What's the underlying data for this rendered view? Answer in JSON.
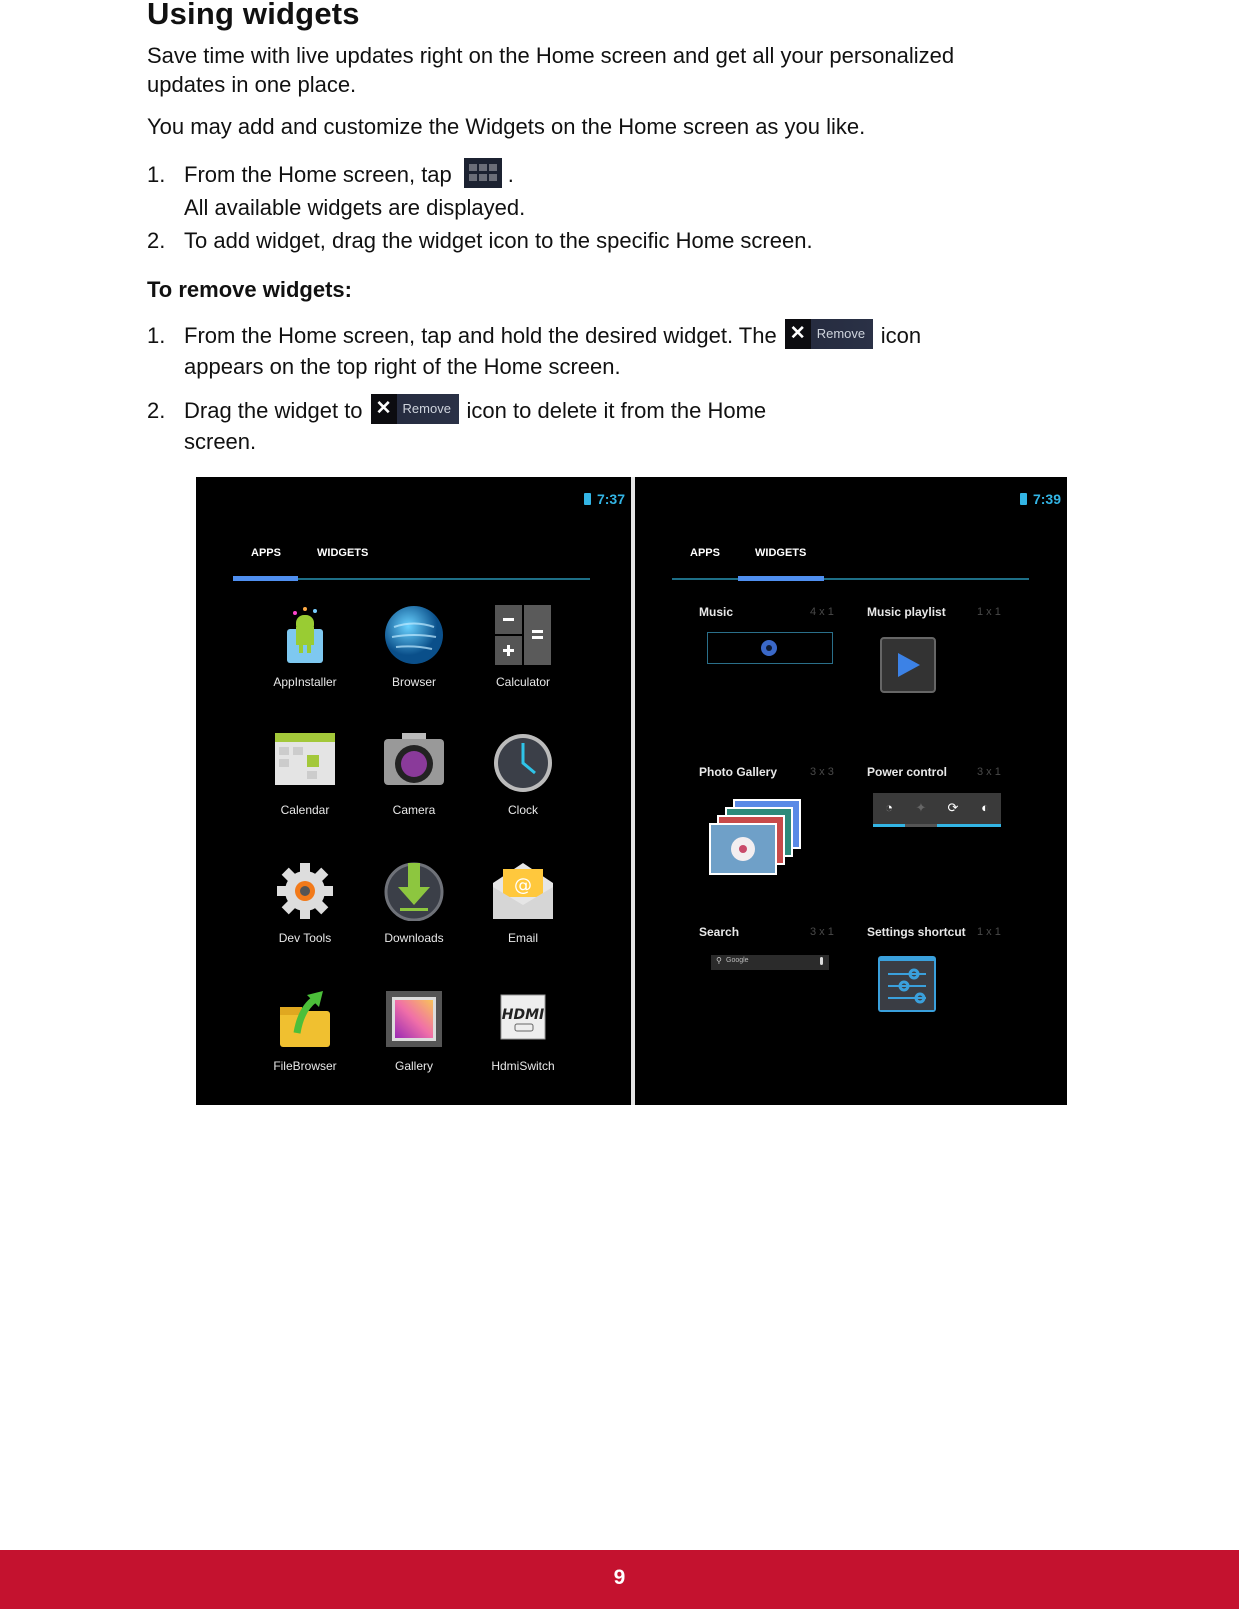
{
  "title": "Using widgets",
  "intro": [
    "Save time with live updates right on the Home screen and get all your personalized",
    "updates in one place.",
    "You may add and customize the Widgets on the Home screen as you like."
  ],
  "add_steps": [
    {
      "num": "1.",
      "text_before": "From the Home screen, tap",
      "icon": "apps-grid-icon",
      "text_after": ".",
      "sub": "All available widgets are displayed."
    },
    {
      "num": "2.",
      "text": "To add widget, drag the widget icon to the specific Home screen."
    }
  ],
  "remove_heading": "To remove widgets:",
  "remove_steps": [
    {
      "num": "1.",
      "text_before": "From the Home screen, tap and hold the desired widget. The",
      "icon_label": "Remove",
      "text_after": "icon",
      "line2": "appears on the top right of the Home screen."
    },
    {
      "num": "2.",
      "text_before": "Drag the widget to",
      "icon_label": "Remove",
      "text_after": "icon to delete it from the Home",
      "line2": "screen."
    }
  ],
  "remove_icon": {
    "x_glyph": "✕",
    "label": "Remove"
  },
  "screens": {
    "left": {
      "time": "7:37",
      "tabs": [
        "APPS",
        "WIDGETS"
      ],
      "active_tab": "APPS",
      "apps": [
        "AppInstaller",
        "Browser",
        "Calculator",
        "Calendar",
        "Camera",
        "Clock",
        "Dev Tools",
        "Downloads",
        "Email",
        "FileBrowser",
        "Gallery",
        "HdmiSwitch"
      ]
    },
    "right": {
      "time": "7:39",
      "tabs": [
        "APPS",
        "WIDGETS"
      ],
      "active_tab": "WIDGETS",
      "widgets": [
        {
          "name": "Music",
          "size": "4 x 1"
        },
        {
          "name": "Music playlist",
          "size": "1 x 1"
        },
        {
          "name": "Photo Gallery",
          "size": "3 x 3"
        },
        {
          "name": "Power control",
          "size": "3 x 1"
        },
        {
          "name": "Search",
          "size": "3 x 1"
        },
        {
          "name": "Settings shortcut",
          "size": "1 x 1"
        }
      ],
      "search_placeholder": "Google"
    }
  },
  "colors": {
    "footer": "#c4122f",
    "accent": "#33b5e5",
    "tab_indicator": "#4f8ff0"
  },
  "footer": {
    "page_number": "9"
  }
}
